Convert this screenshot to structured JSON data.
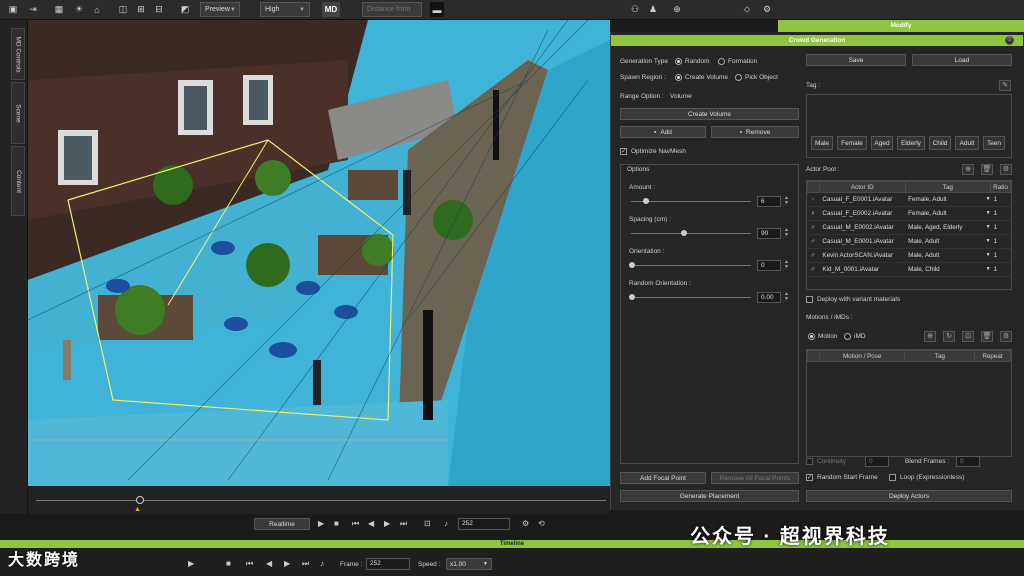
{
  "toolbar": {
    "preview": "Preview",
    "quality": "High",
    "md_logo": "MD",
    "center_field": "Distance from"
  },
  "sidebar_tabs": [
    "MD Controls",
    "Scene",
    "Content"
  ],
  "modify_tab": "Modify",
  "panel": {
    "title": "Crowd Generation",
    "generation_type_label": "Generation Type",
    "generation_types": [
      "Random",
      "Formation"
    ],
    "spawn_region_label": "Spawn Region :",
    "spawn_regions": [
      "Create Volume",
      "Pick Object"
    ],
    "range_option_label": "Range Option :",
    "range_option_value": "Volume",
    "create_volume": "Create Volume",
    "add": "Add",
    "remove": "Remove",
    "optimize_navmesh": "Optimize NavMesh",
    "options_label": "Options",
    "amount_label": "Amount :",
    "amount": "6",
    "spacing_label": "Spacing (cm) :",
    "spacing": "90",
    "orientation_label": "Orientation :",
    "orientation": "0",
    "random_orientation_label": "Random Orientation :",
    "random_orientation": "0.00",
    "add_focal_point": "Add Focal Point",
    "remove_focal_point": "Remove All Focal Points",
    "generate_placement": "Generate Placement",
    "save": "Save",
    "load": "Load",
    "tag_label": "Tag :",
    "tags": [
      "Male",
      "Female",
      "Aged",
      "Elderly",
      "Child",
      "Adult",
      "Teen"
    ],
    "actor_pool_label": "Actor Pool :",
    "actor_headers": [
      "Actor ID",
      "Tag",
      "Ratio"
    ],
    "actors": [
      {
        "id": "Casual_F_E0001.iAvatar",
        "tag": "Female, Adult",
        "ratio": "1"
      },
      {
        "id": "Casual_F_E0002.iAvatar",
        "tag": "Female, Adult",
        "ratio": "1"
      },
      {
        "id": "Casual_M_E0002.iAvatar",
        "tag": "Male, Aged, Elderly",
        "ratio": "1"
      },
      {
        "id": "Casual_M_E0001.iAvatar",
        "tag": "Male, Adult",
        "ratio": "1"
      },
      {
        "id": "Kevin ActorSCAN.iAvatar",
        "tag": "Male, Adult",
        "ratio": "1"
      },
      {
        "id": "Kid_M_0001.iAvatar",
        "tag": "Male, Child",
        "ratio": "1"
      }
    ],
    "deploy_variant": "Deploy with variant materials",
    "motions_label": "Motions / iMDs :",
    "motion_radio": "Motion",
    "imd_radio": "iMD",
    "motion_headers": [
      "Motion / Pose",
      "Tag",
      "Repeat"
    ],
    "continuity": "Continuity",
    "continuity_val": "0",
    "blend_frames": "Blend Frames :",
    "blend_val": "0",
    "random_start_frame": "Random Start Frame",
    "loop": "Loop (Expressionless)",
    "deploy_actors": "Deploy Actors"
  },
  "playback": {
    "realtime": "Realtime",
    "frame": "252"
  },
  "bottom": {
    "timeline": "Timeline",
    "frame_label": "Frame :",
    "frame": "252",
    "speed_label": "Speed :",
    "speed": "x1.00"
  },
  "watermark": {
    "left": "大数跨境",
    "right": "公众号 · 超视界科技"
  }
}
